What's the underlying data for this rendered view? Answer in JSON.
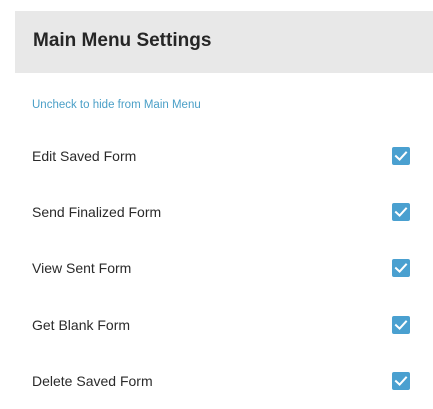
{
  "header": {
    "title": "Main Menu Settings"
  },
  "section": {
    "label": "Uncheck to hide from Main Menu"
  },
  "items": [
    {
      "label": "Edit Saved Form",
      "checked": true
    },
    {
      "label": "Send Finalized Form",
      "checked": true
    },
    {
      "label": "View Sent Form",
      "checked": true
    },
    {
      "label": "Get Blank Form",
      "checked": true
    },
    {
      "label": "Delete Saved Form",
      "checked": true
    }
  ],
  "colors": {
    "accent": "#4aa0d0",
    "section_label": "#4a9fc7",
    "header_bg": "#e8e8e8"
  },
  "icons": {
    "checkbox": "check-icon"
  }
}
